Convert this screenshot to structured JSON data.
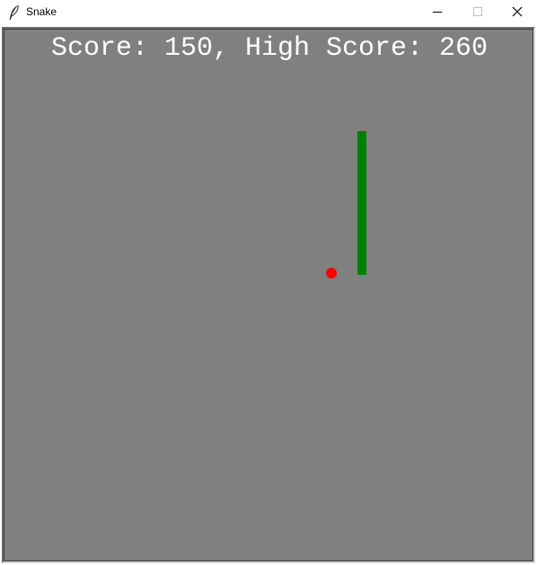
{
  "window": {
    "title": "Snake",
    "icon": "feather-icon",
    "controls": [
      "minimize-icon",
      "maximize-icon",
      "close-icon"
    ]
  },
  "hud": {
    "score_label": "Score",
    "score": 150,
    "high_score_label": "High Score",
    "high_score": 260,
    "text": "Score: 150, High Score: 260"
  },
  "game": {
    "background_color": "#808080",
    "snake_color": "#008000",
    "snake_length_segments": 8,
    "snake_orientation": "vertical",
    "food_color": "#ff0000",
    "food_shape": "circle"
  }
}
